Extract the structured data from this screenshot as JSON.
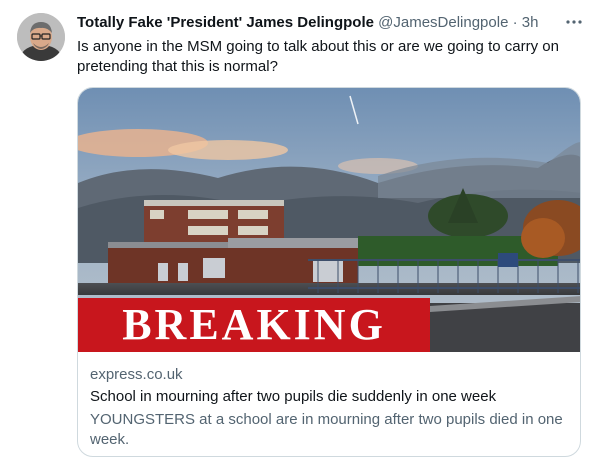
{
  "tweet": {
    "display_name": "Totally Fake 'President' James Delingpole",
    "handle": "@JamesDelingpole",
    "separator": "·",
    "timestamp": "3h",
    "more_icon": "ellipsis-icon",
    "text": "Is anyone in the MSM going to talk about this or are we going to carry on pretending that this is normal?"
  },
  "card": {
    "banner_text": "BREAKING",
    "domain": "express.co.uk",
    "title": "School in mourning after two pupils die suddenly in one week",
    "description": "YOUNGSTERS at a school are in mourning after two pupils died in one week."
  },
  "colors": {
    "banner_red": "#c8161d",
    "secondary_text": "#536471",
    "primary_text": "#0f1419",
    "card_border": "#cfd9de"
  }
}
